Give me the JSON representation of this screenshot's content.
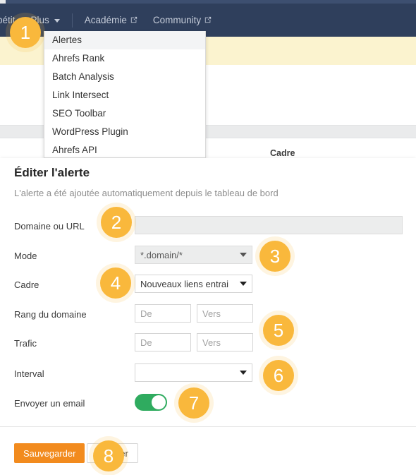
{
  "navbar": {
    "items": [
      {
        "label": "pétit",
        "icon": null,
        "partial": true
      },
      {
        "label": "Plus",
        "icon": "chevron-down-icon",
        "partial": false
      },
      {
        "label": "Académie",
        "icon": "external-link-icon",
        "partial": false
      },
      {
        "label": "Community",
        "icon": "external-link-icon",
        "partial": false
      }
    ]
  },
  "dropdown": {
    "items": [
      {
        "label": "Alertes",
        "active": true
      },
      {
        "label": "Ahrefs Rank",
        "active": false
      },
      {
        "label": "Batch Analysis",
        "active": false
      },
      {
        "label": "Link Intersect",
        "active": false
      },
      {
        "label": "SEO Toolbar",
        "active": false
      },
      {
        "label": "WordPress Plugin",
        "active": false
      },
      {
        "label": "Ahrefs API",
        "active": false
      }
    ]
  },
  "table": {
    "column_header": "Cadre"
  },
  "modal": {
    "title": "Éditer l'alerte",
    "subtitle": "L'alerte a été ajoutée automatiquement depuis le tableau de bord",
    "fields": {
      "domain": {
        "label": "Domaine ou URL",
        "value": "",
        "placeholder": "",
        "disabled": true
      },
      "mode": {
        "label": "Mode",
        "value": "*.domain/*",
        "disabled": true
      },
      "scope": {
        "label": "Cadre",
        "value": "Nouveaux liens entrai",
        "disabled": false
      },
      "domain_rank": {
        "label": "Rang du domaine",
        "from_value": "",
        "from_placeholder": "De",
        "to_value": "",
        "to_placeholder": "Vers"
      },
      "traffic": {
        "label": "Trafic",
        "from_value": "",
        "from_placeholder": "De",
        "to_value": "",
        "to_placeholder": "Vers"
      },
      "interval": {
        "label": "Interval",
        "value": "",
        "disabled": false
      },
      "send_email": {
        "label": "Envoyer un email",
        "enabled": true
      }
    },
    "footer": {
      "save_label": "Sauvegarder",
      "cancel_label": "Annuler"
    }
  },
  "badges": [
    {
      "number": "1"
    },
    {
      "number": "2"
    },
    {
      "number": "3"
    },
    {
      "number": "4"
    },
    {
      "number": "5"
    },
    {
      "number": "6"
    },
    {
      "number": "7"
    },
    {
      "number": "8"
    }
  ],
  "colors": {
    "navbar_bg": "#2f3f5c",
    "banner_bg": "#fbf3cf",
    "badge_bg": "#f9b83c",
    "primary_button": "#f28b1e",
    "toggle_on": "#2fab5f"
  }
}
